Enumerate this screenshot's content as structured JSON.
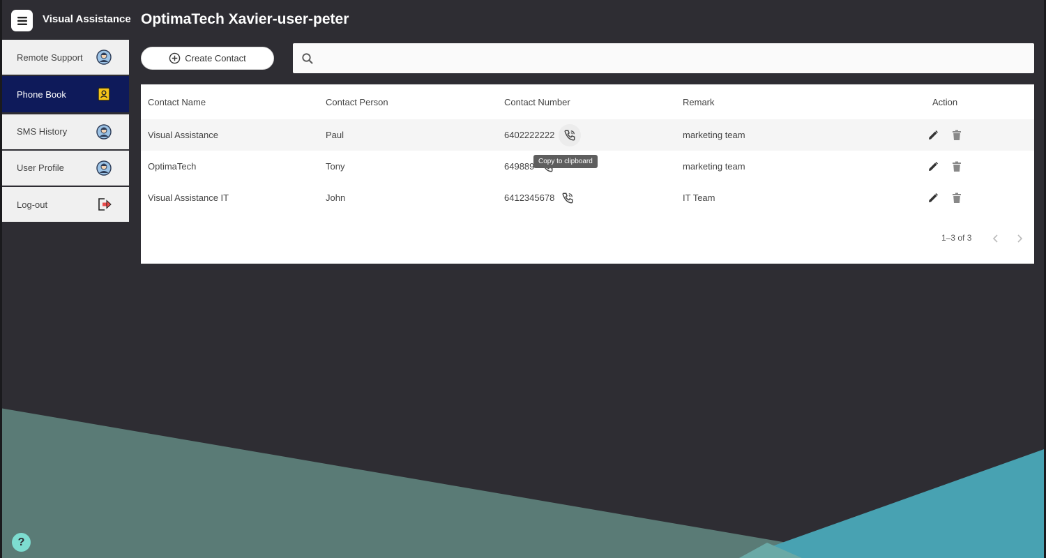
{
  "app": {
    "name": "Visual Assistance"
  },
  "page": {
    "title": "OptimaTech Xavier-user-peter"
  },
  "sidebar": {
    "items": [
      {
        "label": "Remote Support",
        "icon": "user-avatar-icon"
      },
      {
        "label": "Phone Book",
        "icon": "contact-book-icon",
        "active": true
      },
      {
        "label": "SMS History",
        "icon": "user-avatar-icon"
      },
      {
        "label": "User Profile",
        "icon": "user-avatar-icon"
      },
      {
        "label": "Log-out",
        "icon": "logout-icon"
      }
    ]
  },
  "toolbar": {
    "create_label": "Create Contact",
    "search_placeholder": "",
    "search_value": ""
  },
  "table": {
    "columns": [
      "Contact Name",
      "Contact Person",
      "Contact Number",
      "Remark",
      "Action"
    ],
    "rows": [
      {
        "name": "Visual Assistance",
        "person": "Paul",
        "number": "6402222222",
        "remark": "marketing team"
      },
      {
        "name": "OptimaTech",
        "person": "Tony",
        "number": "649889",
        "remark": "marketing team"
      },
      {
        "name": "Visual Assistance IT",
        "person": "John",
        "number": "6412345678",
        "remark": "IT Team"
      }
    ],
    "tooltip": "Copy to clipboard",
    "pagination": "1–3 of 3"
  },
  "help": {
    "label": "?"
  },
  "colors": {
    "background": "#2e2d33",
    "sidebar_active": "#0e1a5a",
    "accent_teal": "#4aa3b3",
    "accent_green": "#5a7b76",
    "help": "#7ddcd0"
  }
}
